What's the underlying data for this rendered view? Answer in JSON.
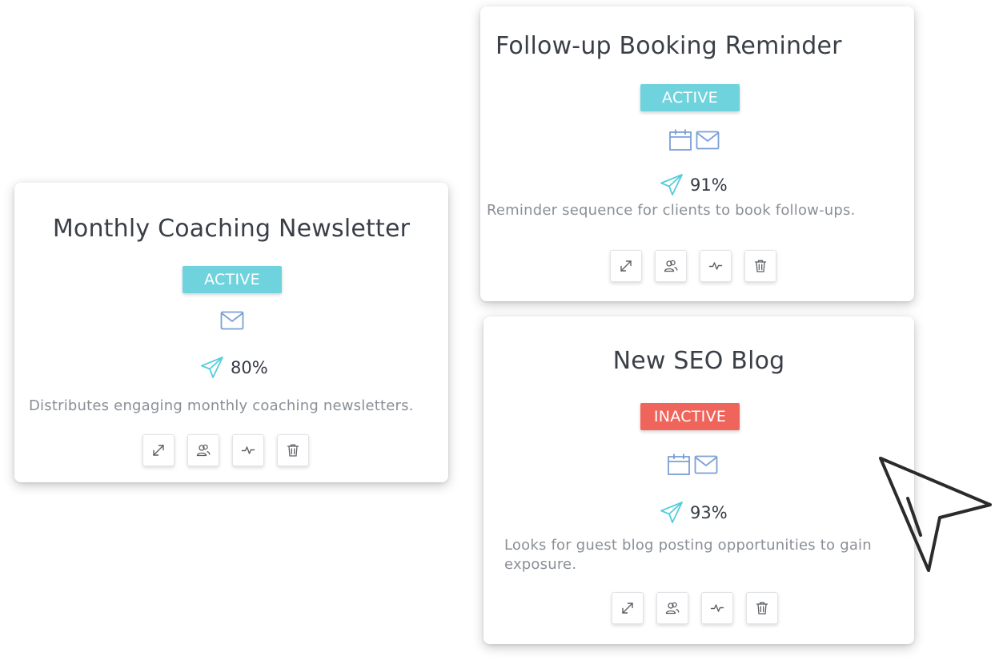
{
  "campaigns": [
    {
      "title": "Monthly Coaching Newsletter",
      "status": "ACTIVE",
      "status_color": "#6fd3dd",
      "channels": [
        "mail-icon"
      ],
      "rate": "80%",
      "description": "Distributes engaging monthly coaching newsletters."
    },
    {
      "title": "Follow-up Booking Reminder",
      "status": "ACTIVE",
      "status_color": "#6fd3dd",
      "channels": [
        "calendar-icon",
        "mail-icon"
      ],
      "rate": "91%",
      "description": "Reminder sequence for clients to book follow-ups."
    },
    {
      "title": "New SEO Blog",
      "status": "INACTIVE",
      "status_color": "#f0655b",
      "channels": [
        "calendar-icon",
        "mail-icon"
      ],
      "rate": "93%",
      "description": "Looks for guest blog posting opportunities to gain exposure."
    }
  ],
  "actions": [
    "expand-icon",
    "users-icon",
    "activity-icon",
    "trash-icon"
  ],
  "colors": {
    "icon_blue": "#7b9fd6",
    "send_teal": "#55cdd9",
    "action_gray": "#5c6066"
  }
}
